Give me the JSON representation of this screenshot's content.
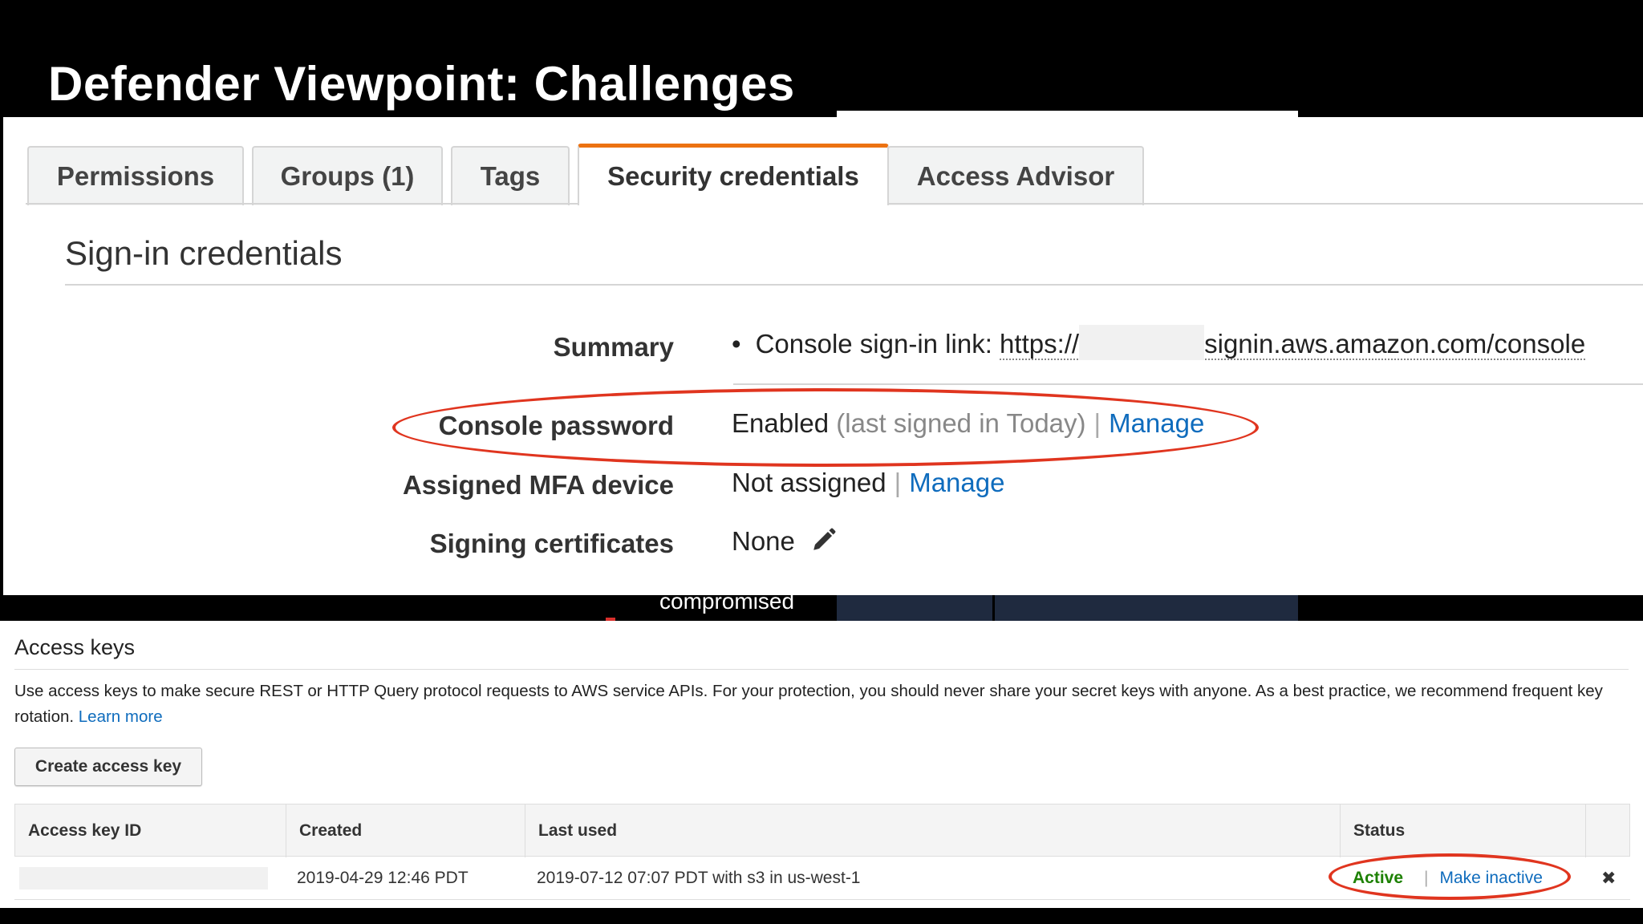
{
  "slide": {
    "title": "Defender Viewpoint: Challenges",
    "background_text": "compromised"
  },
  "tabs": [
    {
      "label": "Permissions",
      "active": false
    },
    {
      "label": "Groups (1)",
      "active": false
    },
    {
      "label": "Tags",
      "active": false
    },
    {
      "label": "Security credentials",
      "active": true
    },
    {
      "label": "Access Advisor",
      "active": false
    }
  ],
  "signin": {
    "section_title": "Sign-in credentials",
    "summary": {
      "label": "Summary",
      "bullet": "•",
      "prefix": "Console sign-in link:",
      "link_start": "https://",
      "link_end": "signin.aws.amazon.com/console"
    },
    "console_password": {
      "label": "Console password",
      "value": "Enabled",
      "note": "(last signed in Today)",
      "action": "Manage"
    },
    "mfa": {
      "label": "Assigned MFA device",
      "value": "Not assigned",
      "action": "Manage"
    },
    "signing_certs": {
      "label": "Signing certificates",
      "value": "None",
      "icon": "pencil-icon"
    }
  },
  "access_keys": {
    "title": "Access keys",
    "description": "Use access keys to make secure REST or HTTP Query protocol requests to AWS service APIs. For your protection, you should never share your secret keys with anyone. As a best practice, we recommend frequent key rotation.",
    "learn_more": "Learn more",
    "create_button": "Create access key",
    "columns": [
      "Access key ID",
      "Created",
      "Last used",
      "Status"
    ],
    "rows": [
      {
        "created": "2019-04-29 12:46 PDT",
        "last_used": "2019-07-12 07:07 PDT with s3 in us-west-1",
        "status": "Active",
        "action": "Make inactive",
        "delete_icon": "✖"
      }
    ]
  },
  "colors": {
    "accent_tab": "#ec7211",
    "link": "#0f6cbd",
    "annotation": "#e0351f",
    "active_status": "#1d8102"
  }
}
